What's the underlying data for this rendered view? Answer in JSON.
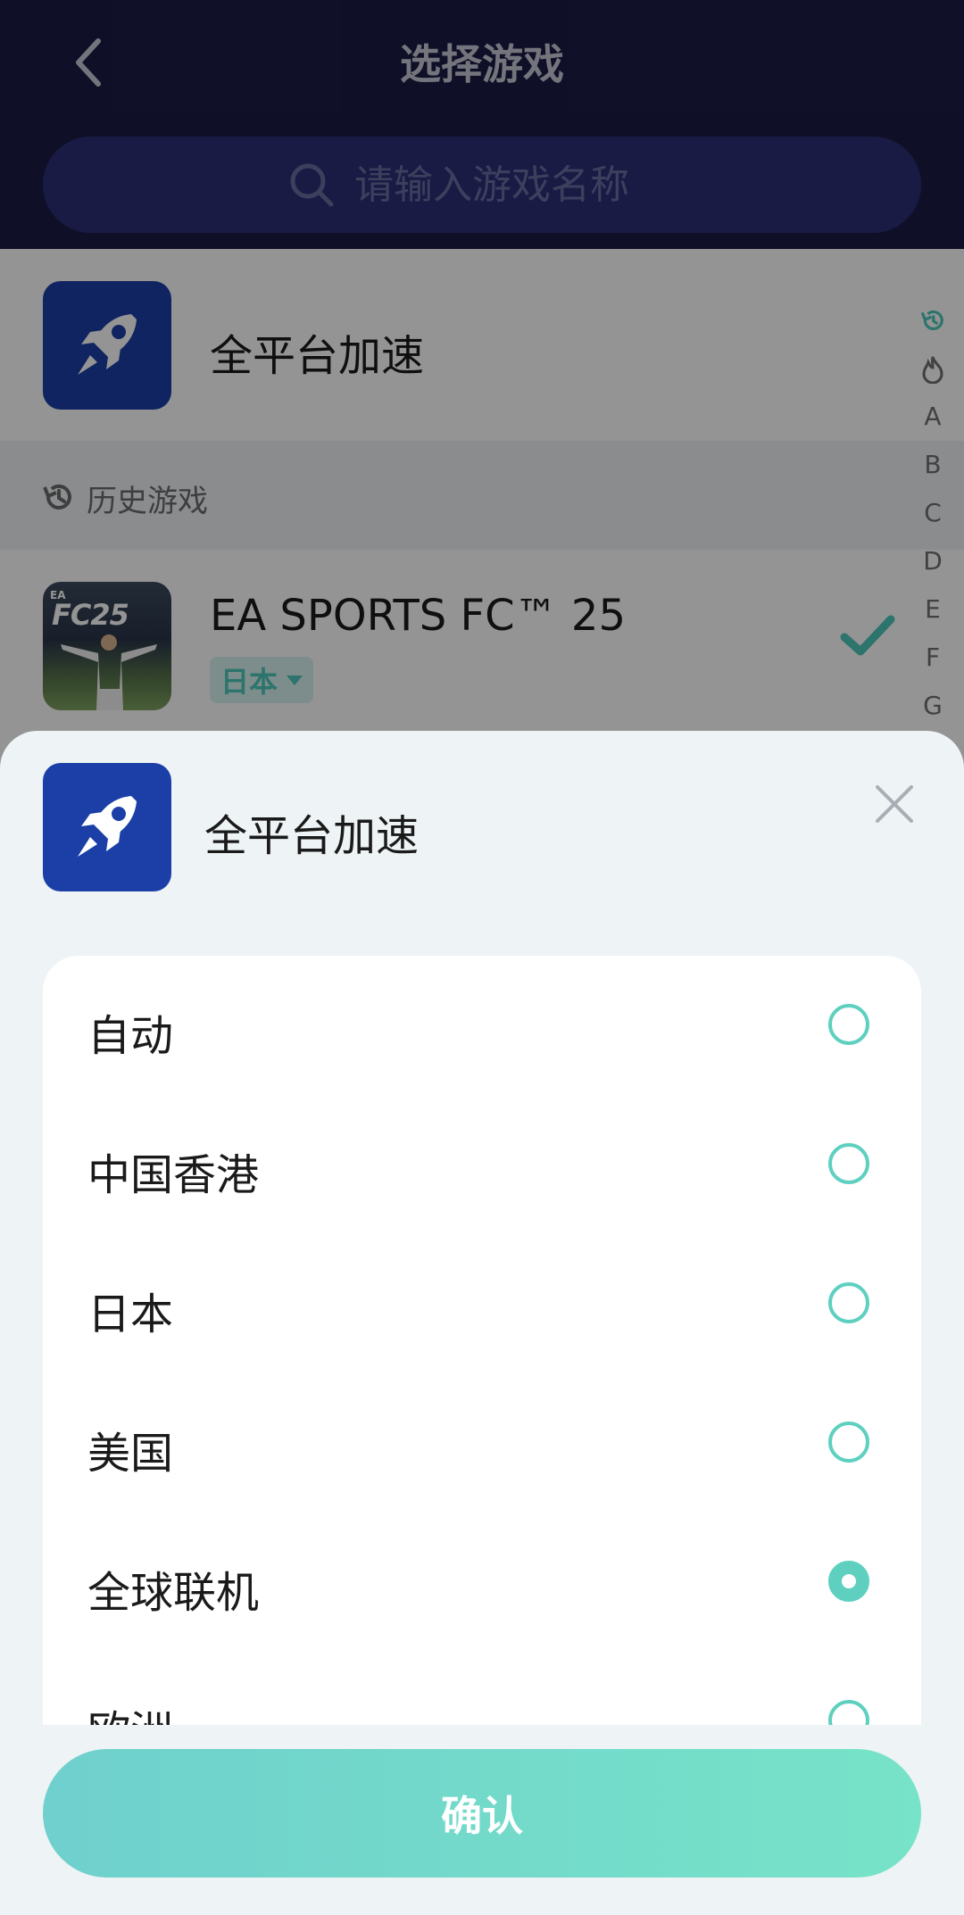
{
  "header": {
    "title": "选择游戏",
    "search_placeholder": "请输入游戏名称"
  },
  "all_platform": {
    "label": "全平台加速"
  },
  "history": {
    "label": "历史游戏"
  },
  "games": [
    {
      "name": "EA SPORTS FC™ 25",
      "region": "日本",
      "cover_text": "FC25",
      "cover_brand": "EA",
      "selected": true
    }
  ],
  "alpha_index": [
    "history-icon",
    "hot-icon",
    "A",
    "B",
    "C",
    "D",
    "E",
    "F",
    "G"
  ],
  "sheet": {
    "title": "全平台加速",
    "options": [
      {
        "label": "自动",
        "checked": false
      },
      {
        "label": "中国香港",
        "checked": false
      },
      {
        "label": "日本",
        "checked": false
      },
      {
        "label": "美国",
        "checked": false
      },
      {
        "label": "全球联机",
        "checked": true
      },
      {
        "label": "欧洲",
        "checked": false
      }
    ],
    "confirm_label": "确认"
  },
  "colors": {
    "header_bg": "#1b1c45",
    "accent": "#5fd0c0",
    "app_icon_bg": "#1b3fa7",
    "sheet_bg": "#eef3f5"
  }
}
